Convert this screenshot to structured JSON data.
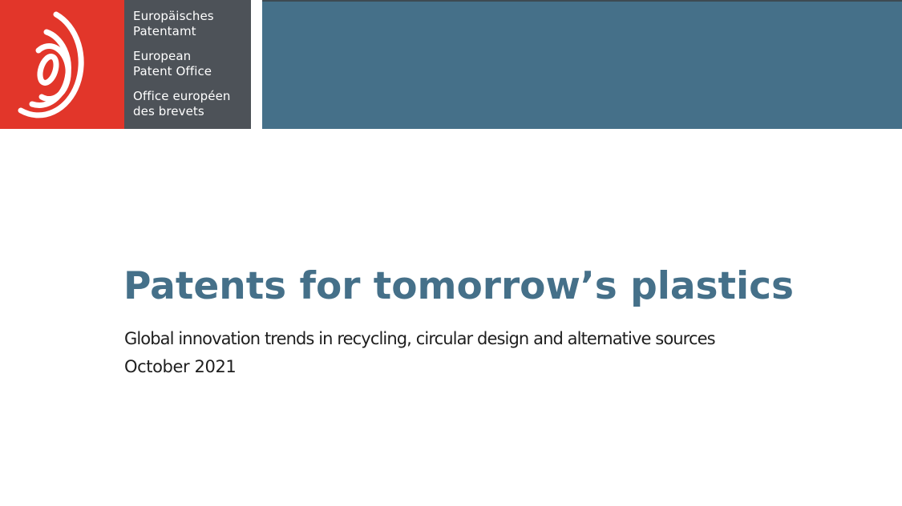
{
  "header": {
    "organization_names": [
      "Europäisches",
      "Patentamt",
      "European",
      "Patent Office",
      "Office européen",
      "des brevets"
    ]
  },
  "logo": {
    "icon": "epo-logo-icon"
  },
  "document": {
    "title": "Patents for tomorrow’s plastics",
    "subtitle": "Global innovation trends in recycling, circular design and alternative sources",
    "date": "October 2021"
  },
  "colors": {
    "logo_red": "#e2362a",
    "name_block_gray": "#4d5258",
    "header_blue": "#457089",
    "title_blue": "#457089",
    "body_text": "#1e1e1e"
  }
}
